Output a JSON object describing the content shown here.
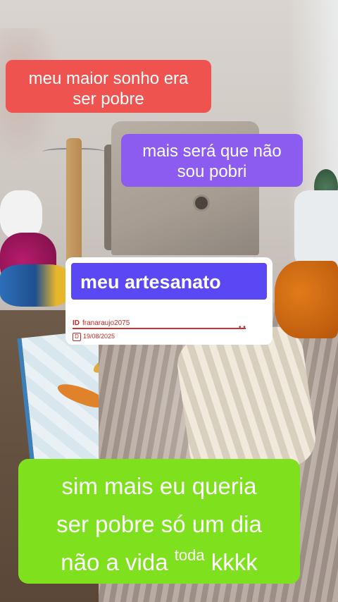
{
  "captions": {
    "red": {
      "line1": "meu maior sonho era",
      "line2": "ser pobre",
      "color": "#ef5350"
    },
    "purple": {
      "line1": "mais será que não",
      "line2": "sou pobri",
      "color": "#8c5cf0"
    },
    "green": {
      "line1": "sim mais eu queria",
      "line2": "ser pobre só um dia",
      "line3_start": "não a vida",
      "line3_raised": "toda",
      "line3_end": "kkkk",
      "color": "#7fe01d"
    }
  },
  "card": {
    "title": "meu artesanato",
    "title_color": "#5a48f5",
    "user_prefix": "ID",
    "username": "franaraujo2075",
    "dots": "• •",
    "date_icon": "D",
    "date": "19/08/2025"
  }
}
